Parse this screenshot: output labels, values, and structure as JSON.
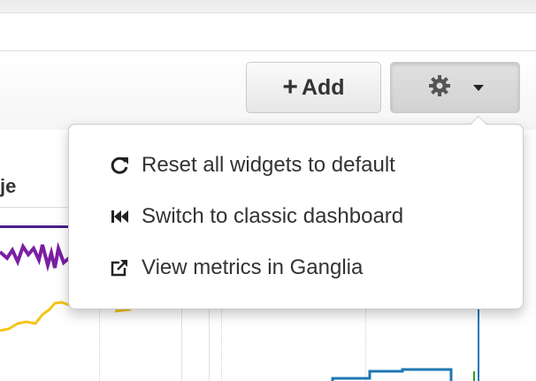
{
  "toolbar": {
    "add_label": "Add",
    "add_icon": "plus-icon",
    "settings_icon": "gear-icon",
    "settings_caret_icon": "caret-down-icon"
  },
  "widget": {
    "title_fragment": "je",
    "series_colors": [
      "#7b1fa2",
      "#f5c518",
      "#1f77b4",
      "#2ca02c"
    ]
  },
  "settings_menu": {
    "items": [
      {
        "label": "Reset all widgets to default",
        "icon": "refresh-icon"
      },
      {
        "label": "Switch to classic dashboard",
        "icon": "backward-icon"
      },
      {
        "label": "View metrics in Ganglia",
        "icon": "external-link-icon"
      }
    ]
  }
}
